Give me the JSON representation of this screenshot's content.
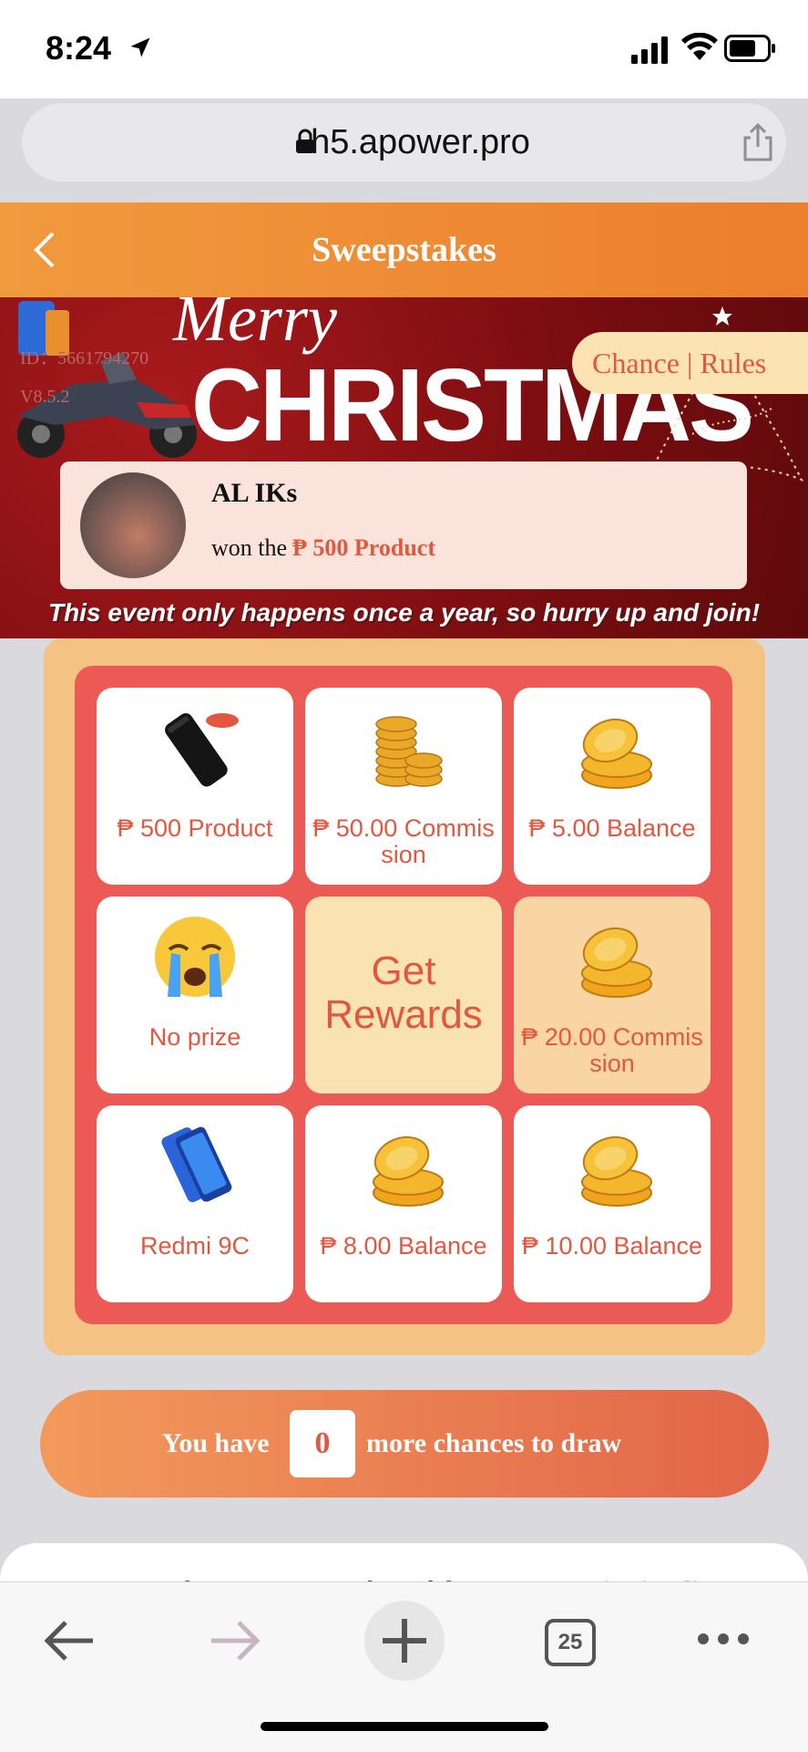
{
  "status": {
    "time": "8:24"
  },
  "browser": {
    "url": "h5.apower.pro",
    "tab_count": "25"
  },
  "header": {
    "title": "Sweepstakes"
  },
  "banner": {
    "merry": "Merry",
    "christmas": "CHRISTMAS",
    "id_text": "ID：5661794270",
    "version_text": "V8.5.2",
    "rules_label": "Chance | Rules",
    "tagline": "This event only happens once a year, so hurry up and join!"
  },
  "winner": {
    "name": "AL IKs",
    "won_text": "won the",
    "prize": "₱ 500 Product"
  },
  "grid": {
    "cells": [
      {
        "label": "₱ 500 Product",
        "icon": "powerbank-icon"
      },
      {
        "label": "₱ 50.00 Commission",
        "icon": "coin-stack-icon"
      },
      {
        "label": "₱ 5.00 Balance",
        "icon": "coins-icon"
      },
      {
        "label": "No prize",
        "icon": "crying-face-icon"
      },
      {
        "label": "Get Rewards",
        "icon": ""
      },
      {
        "label": "₱ 20.00 Commission",
        "icon": "coins-icon"
      },
      {
        "label": "Redmi 9C",
        "icon": "phone-icon"
      },
      {
        "label": "₱ 8.00 Balance",
        "icon": "coins-icon"
      },
      {
        "label": "₱ 10.00 Balance",
        "icon": "coins-icon"
      }
    ]
  },
  "draw": {
    "prefix": "You have",
    "count": "0",
    "suffix": "more chances to draw"
  },
  "records": {
    "col1": "Draw number",
    "col2": "Number of draws",
    "col3": "Winning list"
  },
  "colors": {
    "accent": "#e4573f",
    "header": "#ec7e2c",
    "grid_outer": "#f4c384",
    "grid_inner": "#ec5a55"
  }
}
